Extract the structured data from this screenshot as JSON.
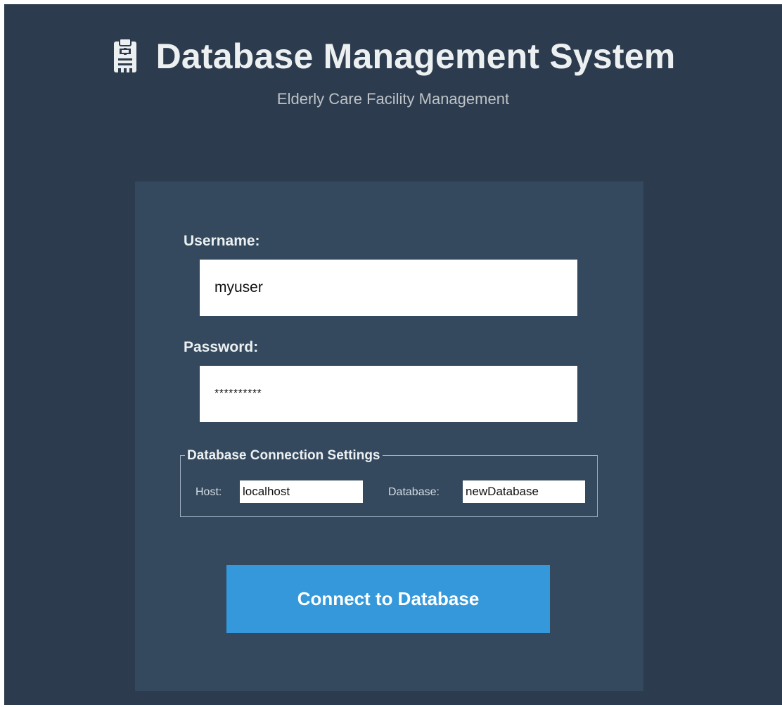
{
  "header": {
    "icon": "clipboard-icon",
    "title": "Database Management System",
    "subtitle": "Elderly Care Facility Management"
  },
  "login": {
    "username_label": "Username:",
    "username_value": "myuser",
    "password_label": "Password:",
    "password_value": "**********"
  },
  "connection": {
    "group_title": "Database Connection Settings",
    "host_label": "Host:",
    "host_value": "localhost",
    "database_label": "Database:",
    "database_value": "newDatabase"
  },
  "actions": {
    "connect_label": "Connect to Database"
  },
  "colors": {
    "background": "#2d3b4e",
    "panel": "#34495e",
    "accent": "#3498db",
    "text": "#ecf0f1"
  }
}
